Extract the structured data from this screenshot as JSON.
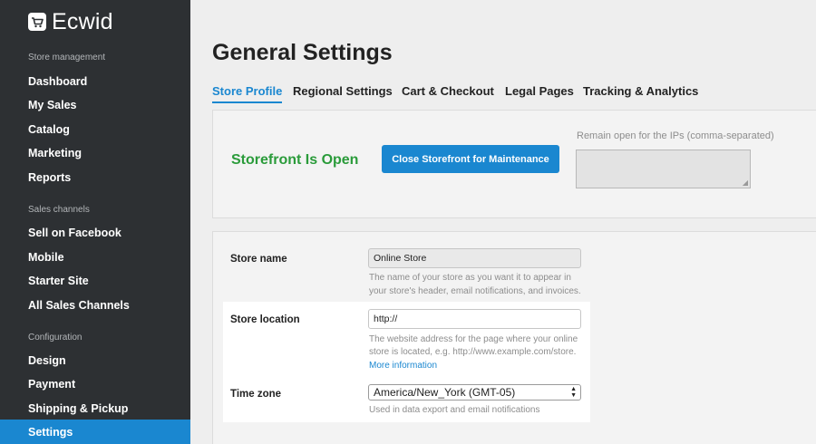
{
  "app": {
    "name": "Ecwid",
    "logo_icon": "cart-icon"
  },
  "sidebar": {
    "sections": [
      {
        "heading": "Store management",
        "items": [
          "Dashboard",
          "My Sales",
          "Catalog",
          "Marketing",
          "Reports"
        ]
      },
      {
        "heading": "Sales channels",
        "items": [
          "Sell on Facebook",
          "Mobile",
          "Starter Site",
          "All Sales Channels"
        ]
      },
      {
        "heading": "Configuration",
        "items": [
          "Design",
          "Payment",
          "Shipping & Pickup",
          "Settings"
        ]
      }
    ],
    "active_item": "Settings",
    "colors": {
      "background": "#2d3033",
      "active": "#1a87d0"
    }
  },
  "page": {
    "title": "General Settings",
    "tabs": [
      "Store Profile",
      "Regional Settings",
      "Cart & Checkout",
      "Legal Pages",
      "Tracking & Analytics"
    ],
    "active_tab": "Store Profile"
  },
  "storefront": {
    "status": "Storefront Is Open",
    "close_button": "Close Storefront for Maintenance",
    "ips_label": "Remain open for the IPs (comma-separated)",
    "ips_value": "",
    "status_color": "#2a9b3a"
  },
  "profile": {
    "store_name": {
      "label": "Store name",
      "value": "Online Store",
      "hint_lines": [
        "The name of your store as you want it to appear in",
        "your store's header, email notifications, and invoices."
      ]
    },
    "store_location": {
      "label": "Store location",
      "value": "http://",
      "hint_lines": [
        "The website address for the page where your online",
        "store is located, e.g. http://www.example.com/store."
      ],
      "link": "More information"
    },
    "time_zone": {
      "label": "Time zone",
      "selected": "America/New_York (GMT-05)",
      "hint": "Used in data export and email notifications"
    }
  }
}
